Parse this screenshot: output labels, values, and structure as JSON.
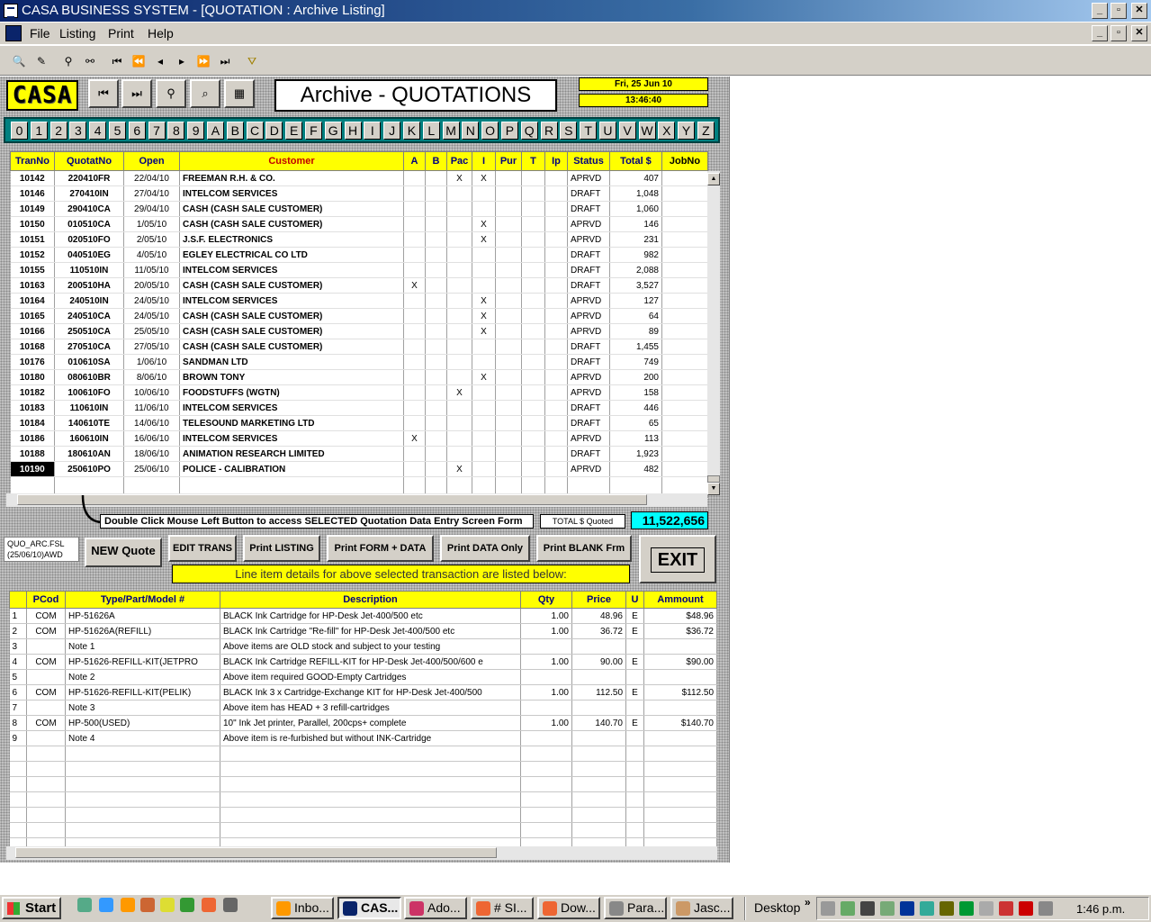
{
  "window": {
    "title": "CASA BUSINESS SYSTEM - [QUOTATION : Archive Listing]",
    "min": "_",
    "max": "▫",
    "close": "✕"
  },
  "menu": [
    "File",
    "Listing",
    "Print",
    "Help"
  ],
  "form": {
    "logo": "CASA",
    "title": "Archive - QUOTATIONS",
    "date": "Fri, 25 Jun 10",
    "time": "13:46:40"
  },
  "alpha": [
    "0",
    "1",
    "2",
    "3",
    "4",
    "5",
    "6",
    "7",
    "8",
    "9",
    "A",
    "B",
    "C",
    "D",
    "E",
    "F",
    "G",
    "H",
    "I",
    "J",
    "K",
    "L",
    "M",
    "N",
    "O",
    "P",
    "Q",
    "R",
    "S",
    "T",
    "U",
    "V",
    "W",
    "X",
    "Y",
    "Z"
  ],
  "quotes": {
    "headers": [
      "TranNo",
      "QuotatNo",
      "Open",
      "Customer",
      "A",
      "B",
      "Pac",
      "I",
      "Pur",
      "T",
      "Ip",
      "Status",
      "Total $",
      "JobNo"
    ],
    "rows": [
      [
        "10142",
        "220410FR",
        "22/04/10",
        "FREEMAN R.H. & CO.",
        "",
        "",
        "X",
        "X",
        "",
        "",
        "",
        "APRVD",
        "407",
        ""
      ],
      [
        "10146",
        "270410IN",
        "27/04/10",
        "INTELCOM SERVICES",
        "",
        "",
        "",
        "",
        "",
        "",
        "",
        "DRAFT",
        "1,048",
        ""
      ],
      [
        "10149",
        "290410CA",
        "29/04/10",
        "CASH (CASH SALE CUSTOMER)",
        "",
        "",
        "",
        "",
        "",
        "",
        "",
        "DRAFT",
        "1,060",
        ""
      ],
      [
        "10150",
        "010510CA",
        "1/05/10",
        "CASH (CASH SALE CUSTOMER)",
        "",
        "",
        "",
        "X",
        "",
        "",
        "",
        "APRVD",
        "146",
        ""
      ],
      [
        "10151",
        "020510FO",
        "2/05/10",
        "J.S.F. ELECTRONICS",
        "",
        "",
        "",
        "X",
        "",
        "",
        "",
        "APRVD",
        "231",
        ""
      ],
      [
        "10152",
        "040510EG",
        "4/05/10",
        "EGLEY ELECTRICAL CO LTD",
        "",
        "",
        "",
        "",
        "",
        "",
        "",
        "DRAFT",
        "982",
        ""
      ],
      [
        "10155",
        "110510IN",
        "11/05/10",
        "INTELCOM SERVICES",
        "",
        "",
        "",
        "",
        "",
        "",
        "",
        "DRAFT",
        "2,088",
        ""
      ],
      [
        "10163",
        "200510HA",
        "20/05/10",
        "CASH (CASH SALE CUSTOMER)",
        "X",
        "",
        "",
        "",
        "",
        "",
        "",
        "DRAFT",
        "3,527",
        ""
      ],
      [
        "10164",
        "240510IN",
        "24/05/10",
        "INTELCOM SERVICES",
        "",
        "",
        "",
        "X",
        "",
        "",
        "",
        "APRVD",
        "127",
        ""
      ],
      [
        "10165",
        "240510CA",
        "24/05/10",
        "CASH (CASH SALE CUSTOMER)",
        "",
        "",
        "",
        "X",
        "",
        "",
        "",
        "APRVD",
        "64",
        ""
      ],
      [
        "10166",
        "250510CA",
        "25/05/10",
        "CASH (CASH SALE CUSTOMER)",
        "",
        "",
        "",
        "X",
        "",
        "",
        "",
        "APRVD",
        "89",
        ""
      ],
      [
        "10168",
        "270510CA",
        "27/05/10",
        "CASH (CASH SALE CUSTOMER)",
        "",
        "",
        "",
        "",
        "",
        "",
        "",
        "DRAFT",
        "1,455",
        ""
      ],
      [
        "10176",
        "010610SA",
        "1/06/10",
        "SANDMAN LTD",
        "",
        "",
        "",
        "",
        "",
        "",
        "",
        "DRAFT",
        "749",
        ""
      ],
      [
        "10180",
        "080610BR",
        "8/06/10",
        "BROWN TONY",
        "",
        "",
        "",
        "X",
        "",
        "",
        "",
        "APRVD",
        "200",
        ""
      ],
      [
        "10182",
        "100610FO",
        "10/06/10",
        "FOODSTUFFS (WGTN)",
        "",
        "",
        "X",
        "",
        "",
        "",
        "",
        "APRVD",
        "158",
        ""
      ],
      [
        "10183",
        "110610IN",
        "11/06/10",
        "INTELCOM SERVICES",
        "",
        "",
        "",
        "",
        "",
        "",
        "",
        "DRAFT",
        "446",
        ""
      ],
      [
        "10184",
        "140610TE",
        "14/06/10",
        "TELESOUND MARKETING LTD",
        "",
        "",
        "",
        "",
        "",
        "",
        "",
        "DRAFT",
        "65",
        ""
      ],
      [
        "10186",
        "160610IN",
        "16/06/10",
        "INTELCOM SERVICES",
        "X",
        "",
        "",
        "",
        "",
        "",
        "",
        "APRVD",
        "113",
        ""
      ],
      [
        "10188",
        "180610AN",
        "18/06/10",
        "ANIMATION RESEARCH LIMITED",
        "",
        "",
        "",
        "",
        "",
        "",
        "",
        "DRAFT",
        "1,923",
        ""
      ],
      [
        "10190",
        "250610PO",
        "25/06/10",
        "POLICE - CALIBRATION",
        "",
        "",
        "X",
        "",
        "",
        "",
        "",
        "APRVD",
        "482",
        ""
      ]
    ]
  },
  "hint": "Double Click Mouse Left Button to access SELECTED Quotation Data Entry Screen Form",
  "total": {
    "label": "TOTAL $ Quoted",
    "value": "11,522,656"
  },
  "fsl": {
    "line1": "QUO_ARC.FSL",
    "line2": "(25/06/10)AWD"
  },
  "buttons": {
    "new": "NEW Quote",
    "edit": "EDIT TRANS",
    "plist": "Print LISTING",
    "pform": "Print FORM + DATA",
    "pdata": "Print DATA Only",
    "pblank": "Print BLANK Frm",
    "exit": "EXIT"
  },
  "lineheader": "Line item details for above selected transaction are listed below:",
  "lines": {
    "headers": [
      "",
      "PCod",
      "Type/Part/Model #",
      "Description",
      "Qty",
      "Price",
      "U",
      "Ammount"
    ],
    "rows": [
      [
        "1",
        "COM",
        "HP-51626A",
        "BLACK Ink Cartridge for HP-Desk Jet-400/500 etc",
        "1.00",
        "48.96",
        "E",
        "$48.96"
      ],
      [
        "2",
        "COM",
        "HP-51626A(REFILL)",
        "BLACK Ink Cartridge \"Re-fill\" for HP-Desk Jet-400/500 etc",
        "1.00",
        "36.72",
        "E",
        "$36.72"
      ],
      [
        "3",
        "",
        "Note 1",
        "Above items are OLD stock and subject to your testing",
        "",
        "",
        "",
        ""
      ],
      [
        "4",
        "COM",
        "HP-51626-REFILL-KIT(JETPRO",
        "BLACK Ink Cartridge REFILL-KIT for HP-Desk Jet-400/500/600 e",
        "1.00",
        "90.00",
        "E",
        "$90.00"
      ],
      [
        "5",
        "",
        "Note 2",
        "Above item required GOOD-Empty Cartridges",
        "",
        "",
        "",
        ""
      ],
      [
        "6",
        "COM",
        "HP-51626-REFILL-KIT(PELIK)",
        "BLACK Ink 3 x Cartridge-Exchange KIT for HP-Desk Jet-400/500",
        "1.00",
        "112.50",
        "E",
        "$112.50"
      ],
      [
        "7",
        "",
        "Note 3",
        "Above item has HEAD + 3 refill-cartridges",
        "",
        "",
        "",
        ""
      ],
      [
        "8",
        "COM",
        "HP-500(USED)",
        "10\" Ink Jet printer, Parallel, 200cps+ complete",
        "1.00",
        "140.70",
        "E",
        "$140.70"
      ],
      [
        "9",
        "",
        "Note 4",
        "Above item is re-furbished but without INK-Cartridge",
        "",
        "",
        "",
        ""
      ],
      [
        "",
        "",
        "",
        "",
        "",
        "",
        "",
        ""
      ],
      [
        "",
        "",
        "",
        "",
        "",
        "",
        "",
        ""
      ],
      [
        "",
        "",
        "",
        "",
        "",
        "",
        "",
        ""
      ],
      [
        "",
        "",
        "",
        "",
        "",
        "",
        "",
        ""
      ],
      [
        "",
        "",
        "",
        "",
        "",
        "",
        "",
        ""
      ],
      [
        "",
        "",
        "",
        "",
        "",
        "",
        "",
        ""
      ],
      [
        "",
        "",
        "",
        "",
        "",
        "",
        "",
        ""
      ]
    ]
  },
  "taskbar": {
    "start": "Start",
    "apps": [
      "Inbo...",
      "CAS...",
      "Ado...",
      "# SI...",
      "Dow...",
      "Para...",
      "Jasc..."
    ],
    "desktop": "Desktop",
    "chevron": "»",
    "clock": "1:46 p.m."
  }
}
